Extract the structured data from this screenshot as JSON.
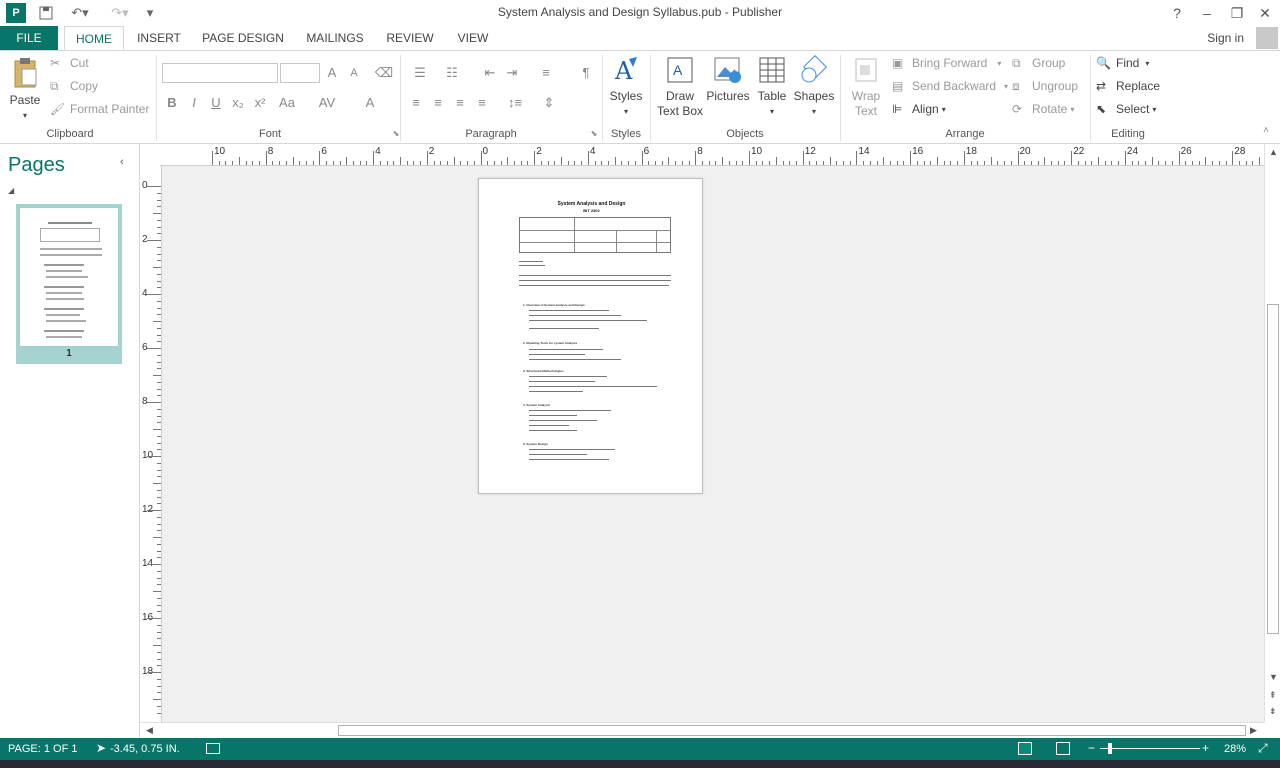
{
  "window": {
    "title": "System Analysis and Design Syllabus.pub - Publisher",
    "help": "?",
    "minimize": "–",
    "restore": "❐",
    "close": "✕"
  },
  "tabs": [
    {
      "label": "FILE"
    },
    {
      "label": "HOME"
    },
    {
      "label": "INSERT"
    },
    {
      "label": "PAGE DESIGN"
    },
    {
      "label": "MAILINGS"
    },
    {
      "label": "REVIEW"
    },
    {
      "label": "VIEW"
    }
  ],
  "account": {
    "sign_in": "Sign in"
  },
  "ribbon": {
    "clipboard": {
      "paste": "Paste",
      "cut": "Cut",
      "copy": "Copy",
      "format_painter": "Format Painter",
      "label": "Clipboard"
    },
    "font": {
      "label": "Font",
      "bold": "B",
      "italic": "I",
      "underline": "U",
      "subscript": "x₂",
      "superscript": "x²",
      "case": "Aa",
      "grow": "A",
      "shrink": "A",
      "spacing": "AV",
      "color": "A"
    },
    "paragraph": {
      "label": "Paragraph",
      "pilcrow": "¶"
    },
    "styles": {
      "button": "Styles",
      "label": "Styles"
    },
    "objects": {
      "draw_text_box": "Draw Text Box",
      "pictures": "Pictures",
      "table": "Table",
      "shapes": "Shapes",
      "label": "Objects"
    },
    "arrange": {
      "wrap_text": "Wrap Text",
      "bring_forward": "Bring Forward",
      "send_backward": "Send Backward",
      "align": "Align",
      "group": "Group",
      "ungroup": "Ungroup",
      "rotate": "Rotate",
      "label": "Arrange"
    },
    "editing": {
      "find": "Find",
      "replace": "Replace",
      "select": "Select",
      "label": "Editing"
    }
  },
  "pages_pane": {
    "title": "Pages",
    "page_number": "1"
  },
  "rulers": {
    "horizontal": [
      "10",
      "8",
      "6",
      "4",
      "2",
      "0",
      "2",
      "4",
      "6",
      "8",
      "10",
      "12",
      "14",
      "16",
      "18",
      "20",
      "22",
      "24",
      "26",
      "28"
    ],
    "vertical": [
      "0",
      "2",
      "4",
      "6",
      "8",
      "10",
      "12",
      "14",
      "16",
      "18"
    ]
  },
  "document": {
    "title": "System Analysis and Design",
    "subtitle": "BIT 2302",
    "sections": [
      "1. Overview of System analysis and Design",
      "2. Modeling Tools for system Analysis",
      "3. Structured Methodologies",
      "4. System Analysis",
      "5. System Design"
    ]
  },
  "status": {
    "page": "PAGE: 1 OF 1",
    "position": "-3.45, 0.75 IN.",
    "zoom": "28%"
  },
  "colors": {
    "accent": "#077568",
    "page_bg": "#f0f0f0"
  }
}
